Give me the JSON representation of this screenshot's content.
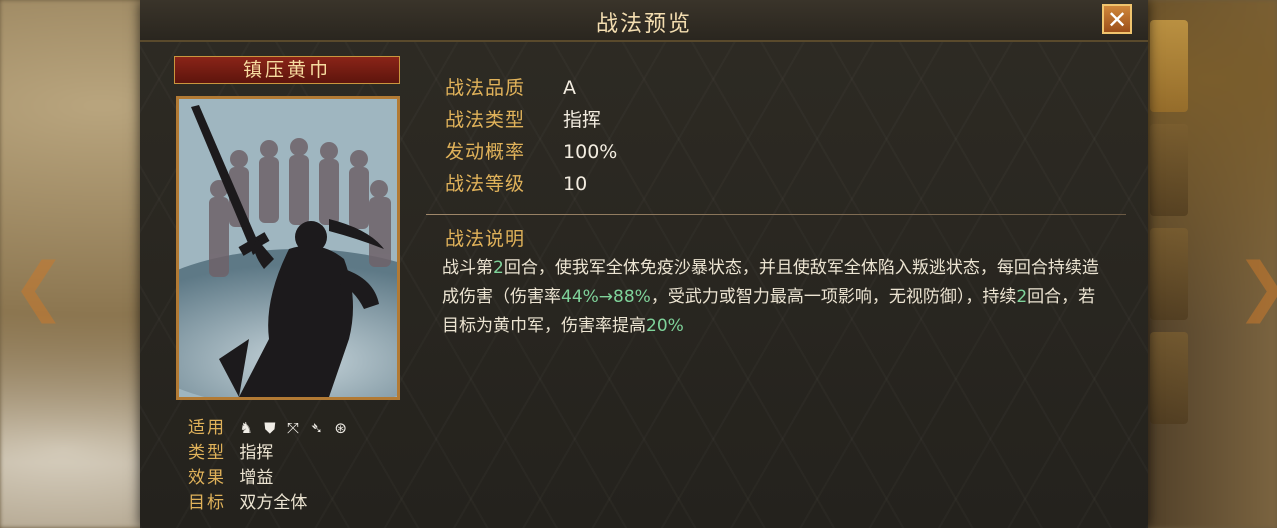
{
  "window": {
    "title": "战法预览",
    "close_label": "✕"
  },
  "skill": {
    "name": "镇压黄巾"
  },
  "properties": [
    {
      "label": "战法品质",
      "value": "A"
    },
    {
      "label": "战法类型",
      "value": "指挥"
    },
    {
      "label": "发动概率",
      "value": "100%"
    },
    {
      "label": "战法等级",
      "value": "10"
    }
  ],
  "description": {
    "heading": "战法说明",
    "seg1": "战斗第",
    "hl1": "2",
    "seg2": "回合，使我军全体免疫沙暴状态，并且使敌军全体陷入叛逃状态，每回合持续造成伤害（伤害率",
    "hl2": "44%→88%",
    "seg3": "，受武力或智力最高一项影响，无视防御），持续",
    "hl3": "2",
    "seg4": "回合，若目标为黄巾军，伤害率提高",
    "hl4": "20%"
  },
  "attributes": {
    "applicable_label": "适用",
    "unit_icons": [
      "cavalry-icon",
      "shield-icon",
      "bow-icon",
      "spear-icon",
      "siege-icon"
    ],
    "type_label": "类型",
    "type_value": "指挥",
    "effect_label": "效果",
    "effect_value": "增益",
    "target_label": "目标",
    "target_value": "双方全体"
  },
  "colors": {
    "gold_label": "#e0b25a",
    "highlight_green": "#7fd39a",
    "banner_red": "#8a2418"
  }
}
